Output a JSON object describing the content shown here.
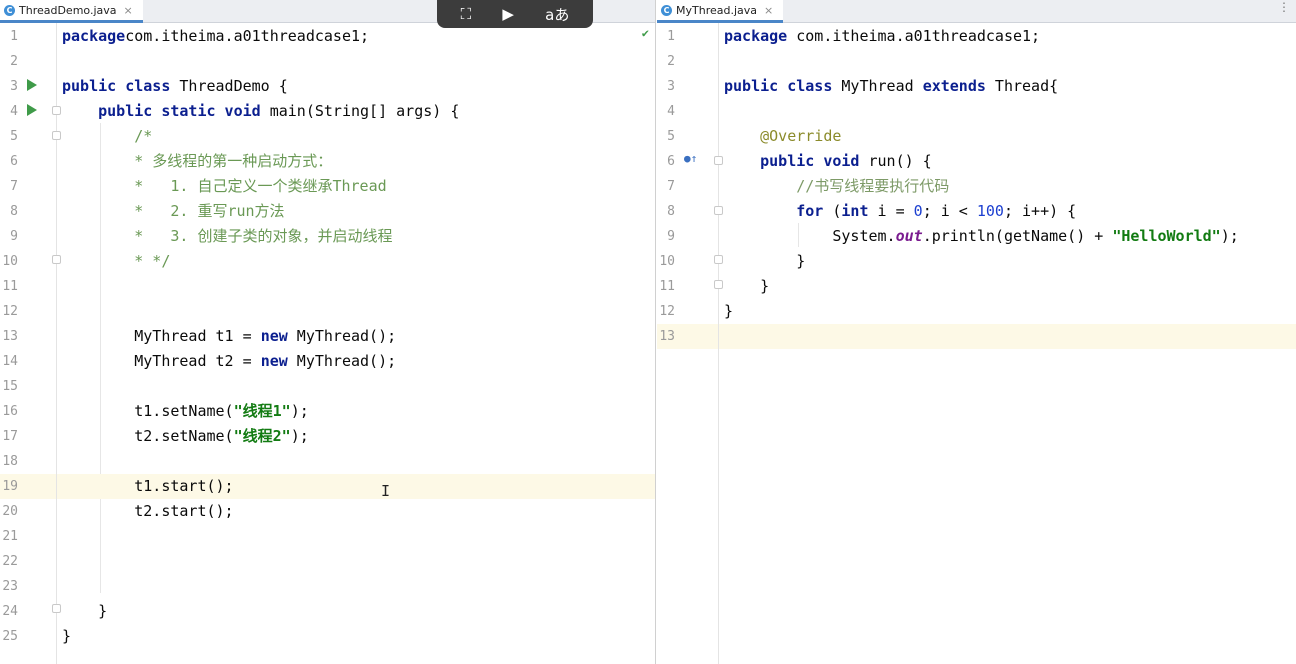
{
  "left_editor": {
    "tab_label": "ThreadDemo.java",
    "lines": [
      [
        [
          "kw",
          "package"
        ],
        [
          "",
          "com.itheima.a01threadcase1;"
        ]
      ],
      [],
      [
        [
          "kw",
          "public class"
        ],
        [
          "",
          " ThreadDemo {"
        ]
      ],
      [
        [
          "",
          "    "
        ],
        [
          "kw",
          "public static void"
        ],
        [
          "",
          " main(String[] args) {"
        ]
      ],
      [
        [
          "cmdoc",
          "        /*"
        ]
      ],
      [
        [
          "cmdoc",
          "        * 多线程的第一种启动方式："
        ]
      ],
      [
        [
          "cmdoc",
          "        *   1. 自己定义一个类继承Thread"
        ]
      ],
      [
        [
          "cmdoc",
          "        *   2. 重写run方法"
        ]
      ],
      [
        [
          "cmdoc",
          "        *   3. 创建子类的对象，并启动线程"
        ]
      ],
      [
        [
          "cmdoc",
          "        * */"
        ]
      ],
      [],
      [],
      [
        [
          "",
          "        MyThread t1 = "
        ],
        [
          "kw",
          "new"
        ],
        [
          "",
          " MyThread();"
        ]
      ],
      [
        [
          "",
          "        MyThread t2 = "
        ],
        [
          "kw",
          "new"
        ],
        [
          "",
          " MyThread();"
        ]
      ],
      [],
      [
        [
          "",
          "        t1.setName("
        ],
        [
          "str",
          "\"线程1\""
        ],
        [
          "",
          ");"
        ]
      ],
      [
        [
          "",
          "        t2.setName("
        ],
        [
          "str",
          "\"线程2\""
        ],
        [
          "",
          ");"
        ]
      ],
      [],
      [
        [
          "",
          "        t1.start();"
        ]
      ],
      [
        [
          "",
          "        t2.start();"
        ]
      ],
      [],
      [],
      [],
      [
        [
          "",
          "    }"
        ]
      ],
      [
        [
          "",
          "}"
        ]
      ]
    ],
    "current_line": 19
  },
  "right_editor": {
    "tab_label": "MyThread.java",
    "lines": [
      [
        [
          "kw",
          "package"
        ],
        [
          "",
          " com.itheima.a01threadcase1;"
        ]
      ],
      [],
      [
        [
          "kw",
          "public class"
        ],
        [
          "",
          " MyThread "
        ],
        [
          "kw",
          "extends"
        ],
        [
          "",
          " Thread{"
        ]
      ],
      [],
      [
        [
          "",
          "    "
        ],
        [
          "ann",
          "@Override"
        ]
      ],
      [
        [
          "",
          "    "
        ],
        [
          "kw",
          "public void"
        ],
        [
          "",
          " run() {"
        ]
      ],
      [
        [
          "",
          "        "
        ],
        [
          "cm",
          "//书写线程要执行代码"
        ]
      ],
      [
        [
          "",
          "        "
        ],
        [
          "kw",
          "for"
        ],
        [
          "",
          " ("
        ],
        [
          "kw",
          "int"
        ],
        [
          "",
          " i = "
        ],
        [
          "num",
          "0"
        ],
        [
          "",
          "; i < "
        ],
        [
          "num",
          "100"
        ],
        [
          "",
          "; i++) {"
        ]
      ],
      [
        [
          "",
          "            System."
        ],
        [
          "fld",
          "out"
        ],
        [
          "",
          ".println(getName() + "
        ],
        [
          "str",
          "\"HelloWorld\""
        ],
        [
          "",
          ");"
        ]
      ],
      [
        [
          "",
          "        }"
        ]
      ],
      [
        [
          "",
          "    }"
        ]
      ],
      [
        [
          "",
          "}"
        ]
      ],
      []
    ],
    "current_line": 13
  },
  "overlay_toolbar": {
    "buttons": [
      "screenshot-icon",
      "video-ai-icon",
      "translate-icon"
    ],
    "translate_glyph": "aあ"
  }
}
